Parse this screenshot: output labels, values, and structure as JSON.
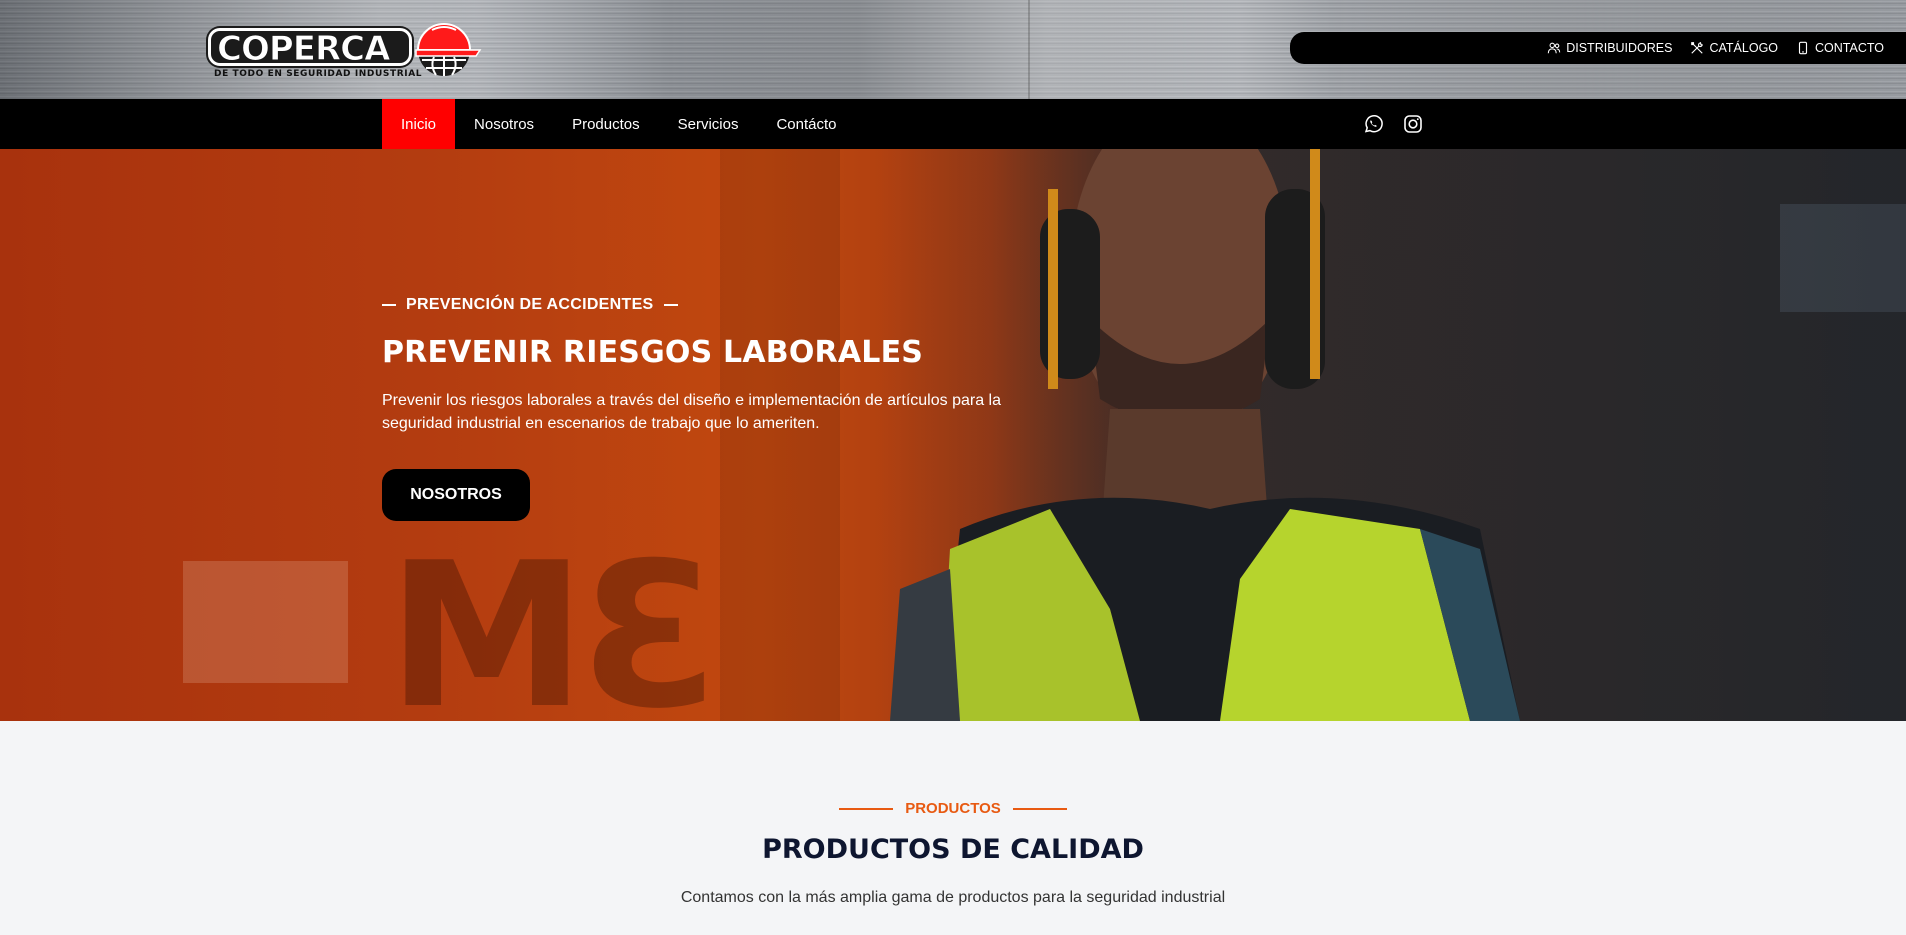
{
  "brand": {
    "name": "COPERCA",
    "tagline": "DE TODO EN SEGURIDAD INDUSTRIAL",
    "logo_icon": "helmet-globe-icon",
    "accent_color": "#ff0000"
  },
  "toplinks": [
    {
      "label": "DISTRIBUIDORES",
      "icon": "users-icon"
    },
    {
      "label": "CATÁLOGO",
      "icon": "tools-icon"
    },
    {
      "label": "CONTACTO",
      "icon": "phone-icon"
    }
  ],
  "nav": {
    "items": [
      {
        "label": "Inicio",
        "active": true
      },
      {
        "label": "Nosotros"
      },
      {
        "label": "Productos"
      },
      {
        "label": "Servicios"
      },
      {
        "label": "Contácto"
      }
    ],
    "social": [
      "whatsapp-icon",
      "instagram-icon"
    ]
  },
  "hero": {
    "kicker": "PREVENCIÓN DE ACCIDENTES",
    "title": "PREVENIR RIESGOS LABORALES",
    "text": "Prevenir los riesgos laborales a través del diseño e implementación de artículos para la seguridad industrial en escenarios de trabajo que lo ameriten.",
    "button": "NOSOTROS",
    "background_color": "#b33c10"
  },
  "products": {
    "kicker": "PRODUCTOS",
    "title": "PRODUCTOS DE CALIDAD",
    "subtitle": "Contamos con la más amplia gama de productos para la seguridad industrial",
    "kicker_color": "#e85a12"
  }
}
